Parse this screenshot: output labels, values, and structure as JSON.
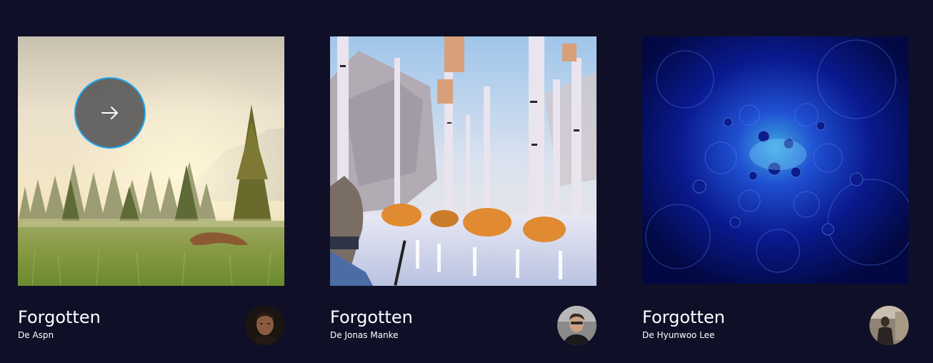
{
  "cards": [
    {
      "title": "Forgotten",
      "author": "De Aspn",
      "thumbnail": "sunlit-forest-meadow-image",
      "hover_icon": "arrow-right-icon",
      "accent": "#1ea7f0"
    },
    {
      "title": "Forgotten",
      "author": "De Jonas Manke",
      "thumbnail": "snowy-birch-forest-image"
    },
    {
      "title": "Forgotten",
      "author": "De Hyunwoo Lee",
      "thumbnail": "blue-bubbles-abstract-image"
    }
  ],
  "colors": {
    "background": "#0f1027",
    "text": "#ffffff",
    "play_button_border": "#1ea7f0"
  }
}
